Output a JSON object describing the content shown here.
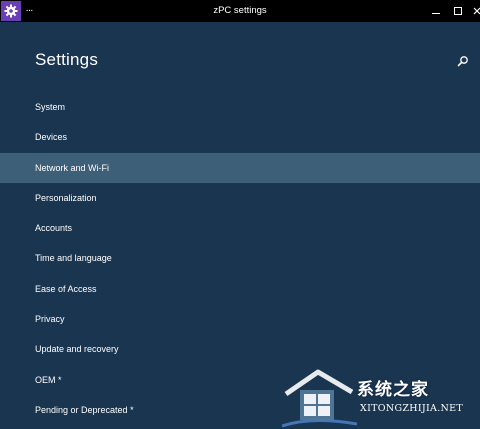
{
  "window": {
    "title": "zPC settings",
    "more_glyph": "···",
    "app_icon": "gear-icon",
    "controls": [
      "minimize-icon",
      "maximize-icon",
      "close-icon"
    ]
  },
  "page": {
    "title": "Settings",
    "search_icon": "search-icon"
  },
  "nav": {
    "selected_index": 2,
    "items": [
      {
        "label": "System"
      },
      {
        "label": "Devices"
      },
      {
        "label": "Network and Wi-Fi"
      },
      {
        "label": "Personalization"
      },
      {
        "label": "Accounts"
      },
      {
        "label": "Time and language"
      },
      {
        "label": "Ease of Access"
      },
      {
        "label": "Privacy"
      },
      {
        "label": "Update and recovery"
      },
      {
        "label": "OEM *"
      },
      {
        "label": "Pending or Deprecated *"
      }
    ]
  },
  "watermark": {
    "text_cn": "系统之家",
    "text_en": "XITONGZHIJIA.NET"
  },
  "colors": {
    "background": "#1a3550",
    "titlebar": "#000000",
    "selected_row": "#3e5f78",
    "app_icon_bg": "#6a3fb5",
    "text": "#ffffff"
  }
}
